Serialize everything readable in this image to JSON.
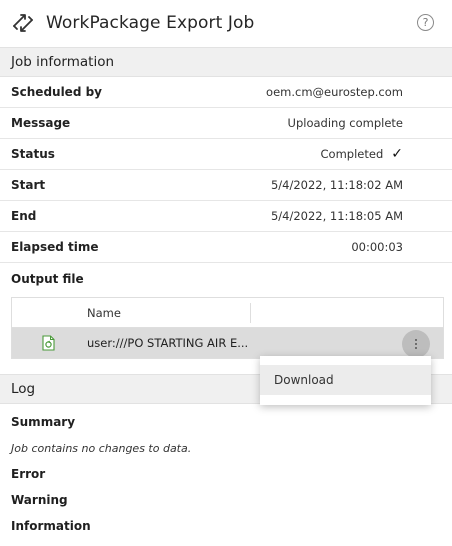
{
  "header": {
    "title": "WorkPackage Export Job",
    "help_glyph": "?"
  },
  "job_info": {
    "heading": "Job information",
    "rows": [
      {
        "label": "Scheduled by",
        "value": "oem.cm@eurostep.com"
      },
      {
        "label": "Message",
        "value": "Uploading complete"
      },
      {
        "label": "Status",
        "value": "Completed",
        "icon": "check-icon"
      },
      {
        "label": "Start",
        "value": "5/4/2022, 11:18:02 AM"
      },
      {
        "label": "End",
        "value": "5/4/2022, 11:18:05 AM"
      },
      {
        "label": "Elapsed time",
        "value": "00:00:03"
      }
    ],
    "output_file_label": "Output file",
    "table": {
      "columns": [
        "Name"
      ],
      "rows": [
        {
          "name": "user:///PO STARTING AIR E...",
          "icon": "file-icon"
        }
      ]
    }
  },
  "context_menu": {
    "items": [
      "Download"
    ]
  },
  "log": {
    "heading": "Log",
    "summary_label": "Summary",
    "summary_text": "Job contains no changes to data.",
    "error_label": "Error",
    "warning_label": "Warning",
    "information_label": "Information"
  },
  "colors": {
    "section_bg": "#f0f0f0",
    "selected_row_bg": "#dcdcdc",
    "file_icon_green": "#4a9a3a"
  }
}
